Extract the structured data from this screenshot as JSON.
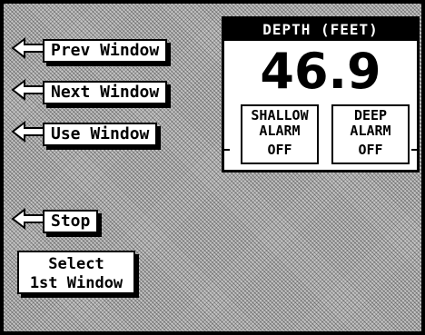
{
  "softkeys": {
    "prev": {
      "label": "Prev Window",
      "icon": "left-arrow-icon"
    },
    "next": {
      "label": "Next Window",
      "icon": "left-arrow-icon"
    },
    "use": {
      "label": "Use Window",
      "icon": "left-arrow-icon"
    },
    "stop": {
      "label": "Stop",
      "icon": "left-arrow-icon"
    }
  },
  "select_box": {
    "line1": "Select",
    "line2": "1st Window"
  },
  "depth_panel": {
    "title": "DEPTH (FEET)",
    "value": "46.9",
    "shallow_alarm": {
      "line1": "SHALLOW",
      "line2": "ALARM",
      "line3": "OFF"
    },
    "deep_alarm": {
      "line1": "DEEP",
      "line2": "ALARM",
      "line3": "OFF"
    }
  },
  "colors": {
    "foreground": "#000000",
    "background": "#ffffff",
    "screen_texture": "#c4c4c4"
  }
}
